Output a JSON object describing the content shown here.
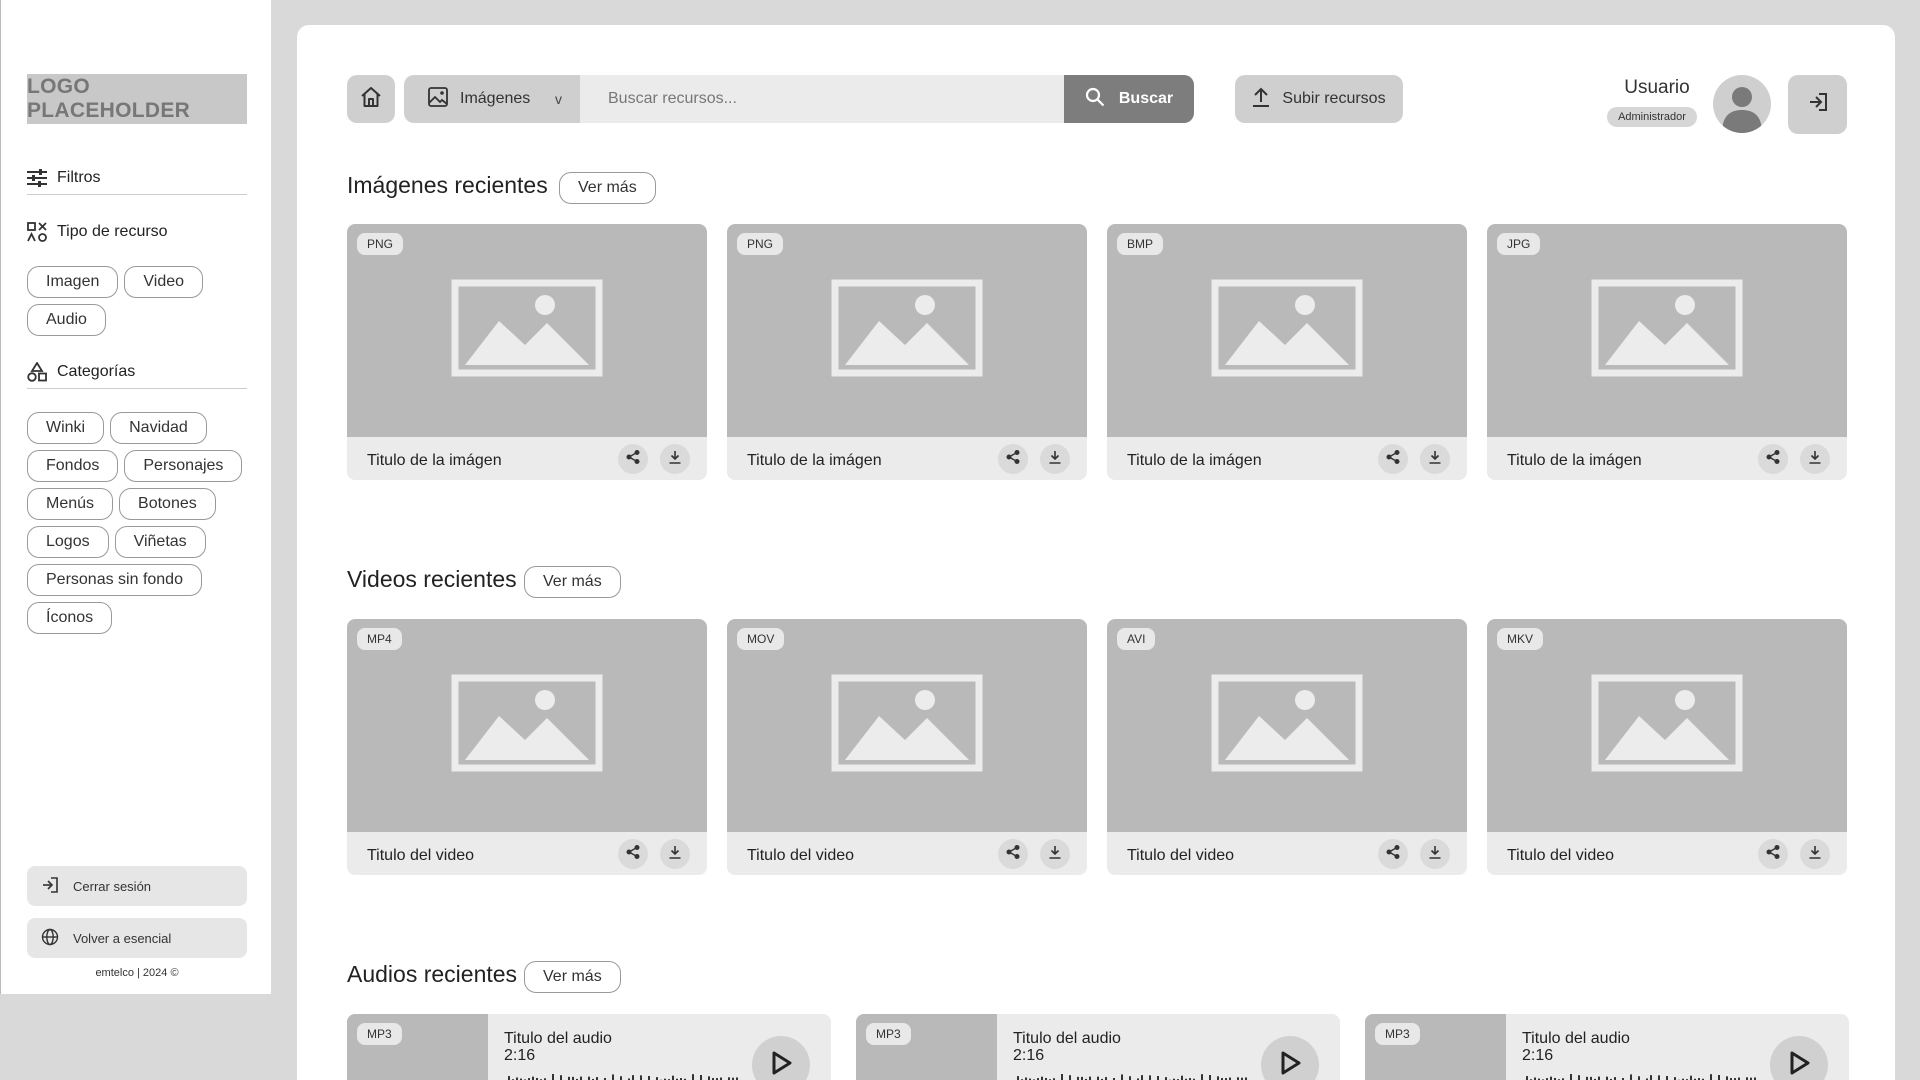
{
  "sidebar": {
    "logo": "LOGO PLACEHOLDER",
    "filters_label": "Filtros",
    "resource_type_label": "Tipo de recurso",
    "resource_types": [
      "Imagen",
      "Video",
      "Audio"
    ],
    "categories_label": "Categorías",
    "categories": [
      "Winki",
      "Navidad",
      "Fondos",
      "Personajes",
      "Menús",
      "Botones",
      "Logos",
      "Viñetas",
      "Personas sin fondo",
      "Íconos"
    ],
    "logout_label": "Cerrar sesión",
    "back_label": "Volver a esencial",
    "footer": "emtelco  | 2024 ©"
  },
  "header": {
    "search_type": "Imágenes",
    "search_type_chevron": "v",
    "search_placeholder": "Buscar recursos...",
    "search_button": "Buscar",
    "upload_button": "Subir recursos",
    "user_name": "Usuario",
    "user_role": "Administrador"
  },
  "images_section": {
    "title": "Imágenes recientes",
    "more": "Ver más",
    "items": [
      {
        "format": "PNG",
        "title": "Titulo de la imágen"
      },
      {
        "format": "PNG",
        "title": "Titulo de la imágen"
      },
      {
        "format": "BMP",
        "title": "Titulo de la imágen"
      },
      {
        "format": "JPG",
        "title": "Titulo de la imágen"
      }
    ]
  },
  "videos_section": {
    "title": "Videos recientes",
    "more": "Ver más",
    "items": [
      {
        "format": "MP4",
        "title": "Titulo del video"
      },
      {
        "format": "MOV",
        "title": "Titulo del video"
      },
      {
        "format": "AVI",
        "title": "Titulo del video"
      },
      {
        "format": "MKV",
        "title": "Titulo del video"
      }
    ]
  },
  "audios_section": {
    "title": "Audios recientes",
    "more": "Ver más",
    "items": [
      {
        "format": "MP3",
        "title": "Titulo del audio",
        "duration": "2:16"
      },
      {
        "format": "MP3",
        "title": "Titulo del audio",
        "duration": "2:16"
      },
      {
        "format": "MP3",
        "title": "Titulo del audio",
        "duration": "2:16"
      }
    ]
  },
  "icons": {
    "home": "home-icon",
    "image": "image-icon",
    "search": "search-icon",
    "upload": "upload-icon",
    "login": "login-icon",
    "share": "share-icon",
    "download": "download-icon",
    "play": "play-icon",
    "filters": "sliders-icon",
    "resource_type": "shapes-icon",
    "categories": "category-icon",
    "globe": "globe-icon"
  },
  "colors": {
    "panel": "#ffffff",
    "background": "#d9d9d9",
    "placeholder": "#b9b9b9",
    "search_button": "#7d7d7d"
  }
}
